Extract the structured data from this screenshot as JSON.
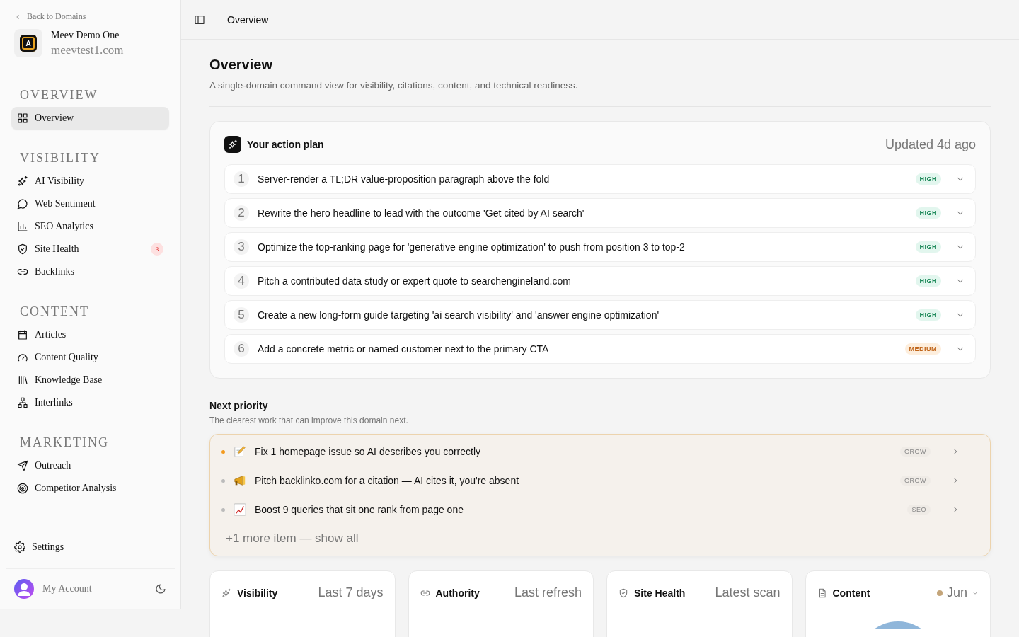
{
  "sidebar": {
    "back_link": "Back to Domains",
    "domain": {
      "logo_letter": "A",
      "name": "Meev Demo One",
      "url": "meevtest1.com"
    },
    "sections": [
      {
        "title": "OVERVIEW",
        "items": [
          {
            "label": "Overview",
            "selected": true
          }
        ]
      },
      {
        "title": "VISIBILITY",
        "items": [
          {
            "label": "AI Visibility",
            "selected": false
          },
          {
            "label": "Web Sentiment",
            "selected": false
          },
          {
            "label": "SEO Analytics",
            "selected": false
          },
          {
            "label": "Site Health",
            "selected": false,
            "badge": "3"
          },
          {
            "label": "Backlinks",
            "selected": false
          }
        ]
      },
      {
        "title": "CONTENT",
        "items": [
          {
            "label": "Articles",
            "selected": false
          },
          {
            "label": "Content Quality",
            "selected": false
          },
          {
            "label": "Knowledge Base",
            "selected": false
          },
          {
            "label": "Interlinks",
            "selected": false
          }
        ]
      },
      {
        "title": "MARKETING",
        "items": [
          {
            "label": "Outreach",
            "selected": false
          },
          {
            "label": "Competitor Analysis",
            "selected": false
          }
        ]
      }
    ],
    "settings": "Settings",
    "account": "My Account"
  },
  "topbar": {
    "title": "Overview"
  },
  "page": {
    "title": "Overview",
    "subtitle": "A single-domain command view for visibility, citations, content, and technical readiness."
  },
  "action_plan": {
    "title": "Your action plan",
    "updated": "Updated 4d ago",
    "items": [
      {
        "number": "1",
        "text": "Server-render a TL;DR value-proposition paragraph above the fold",
        "priority": "HIGH",
        "kind": "high"
      },
      {
        "number": "2",
        "text": "Rewrite the hero headline to lead with the outcome 'Get cited by AI search'",
        "priority": "HIGH",
        "kind": "high"
      },
      {
        "number": "3",
        "text": "Optimize the top-ranking page for 'generative engine optimization' to push from position 3 to top-2",
        "priority": "HIGH",
        "kind": "high"
      },
      {
        "number": "4",
        "text": "Pitch a contributed data study or expert quote to searchengineland.com",
        "priority": "HIGH",
        "kind": "high"
      },
      {
        "number": "5",
        "text": "Create a new long-form guide targeting 'ai search visibility' and 'answer engine optimization'",
        "priority": "HIGH",
        "kind": "high"
      },
      {
        "number": "6",
        "text": "Add a concrete metric or named customer next to the primary CTA",
        "priority": "MEDIUM",
        "kind": "medium"
      }
    ]
  },
  "next_priority": {
    "title": "Next priority",
    "subtitle": "The clearest work that can improve this domain next.",
    "items": [
      {
        "text": "Fix 1 homepage issue so AI describes you correctly",
        "tag": "GROW",
        "selected": true
      },
      {
        "text": "Pitch backlinko.com for a citation — AI cites it, you're absent",
        "tag": "GROW",
        "selected": false
      },
      {
        "text": "Boost 9 queries that sit one rank from page one",
        "tag": "SEO",
        "selected": false
      }
    ],
    "more": "+1 more item — show all"
  },
  "cards": [
    {
      "title": "Visibility",
      "meta": "Last 7 days"
    },
    {
      "title": "Authority",
      "meta": "Last refresh"
    },
    {
      "title": "Site Health",
      "meta": "Latest scan"
    },
    {
      "title": "Content",
      "meta": "Jun",
      "kind": "dropdown",
      "color": "#c4a57a"
    }
  ]
}
